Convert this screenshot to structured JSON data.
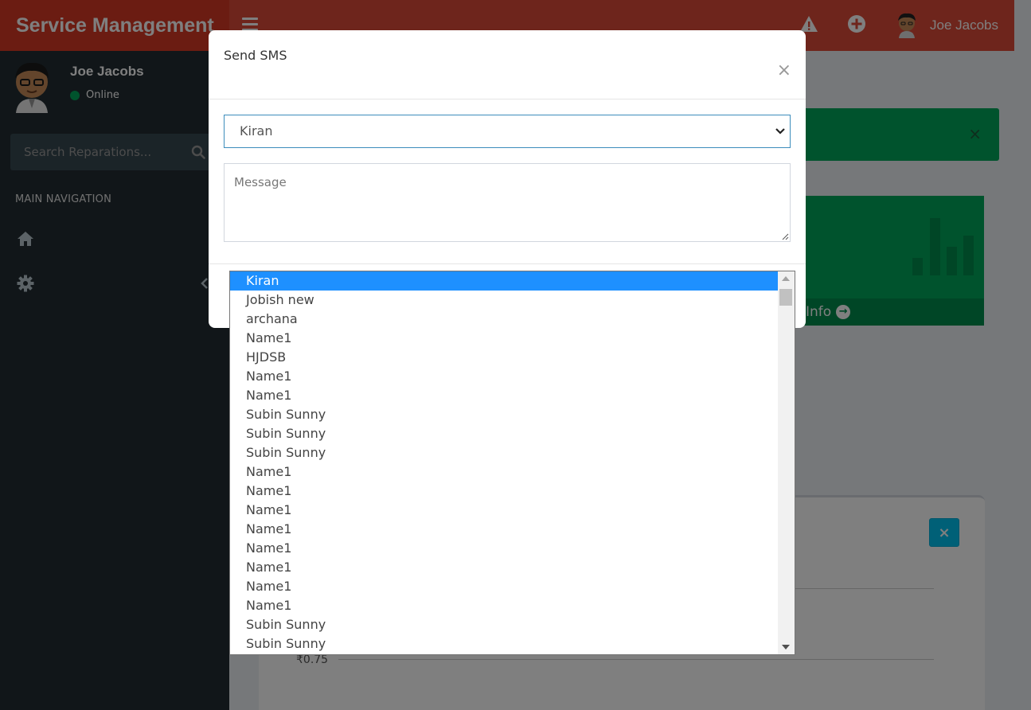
{
  "app": {
    "title": "Service Management",
    "user_name": "Joe Jacobs"
  },
  "sidebar": {
    "user_name": "Joe Jacobs",
    "status": "Online",
    "search_placeholder": "Search Reparations...",
    "header": "MAIN NAVIGATION",
    "items": [
      {
        "icon": "home-icon"
      },
      {
        "icon": "gear-icon"
      }
    ]
  },
  "modal": {
    "title": "Send SMS",
    "close": "×",
    "selected_recipient": "Kiran",
    "message_placeholder": "Message"
  },
  "dropdown": {
    "options": [
      "Kiran",
      "Jobish new",
      "archana",
      "Name1",
      "HJDSB",
      "Name1",
      "Name1",
      "Subin Sunny",
      "Subin Sunny",
      "Subin Sunny",
      "Name1",
      "Name1",
      "Name1",
      "Name1",
      "Name1",
      "Name1",
      "Name1",
      "Name1",
      "Subin Sunny",
      "Subin Sunny"
    ],
    "selected_index": 0
  },
  "background": {
    "info_link": "Info",
    "panel_close": "×",
    "axis_tick": "₹0.75"
  },
  "colors": {
    "header": "#dd4b39",
    "sidebar": "#222d32",
    "success": "#00a65a",
    "selected": "#1e90ff"
  }
}
